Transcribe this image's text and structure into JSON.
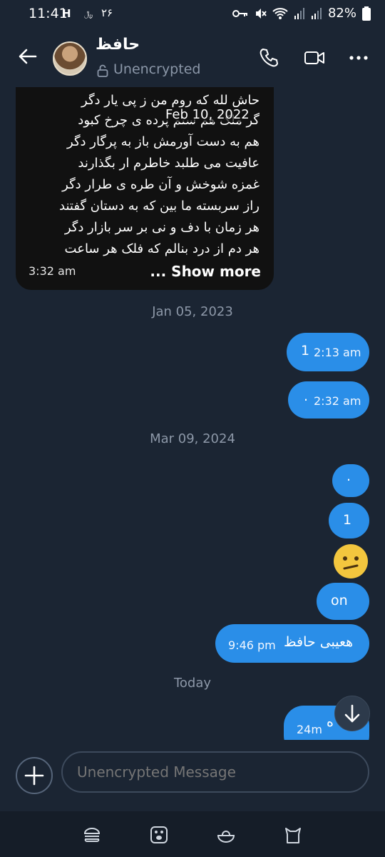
{
  "status_bar": {
    "time": "11:41",
    "indicator_text": "H",
    "small_text": "﷼",
    "number_text": "۲۶",
    "battery": "82%",
    "icons": [
      "key-icon",
      "mute-icon",
      "wifi-icon",
      "signal-icon",
      "signal-icon",
      "battery-icon"
    ]
  },
  "header": {
    "contact_name": "حافظ",
    "encryption_status": "Unencrypted",
    "icons": [
      "back-arrow-icon",
      "lock-icon",
      "phone-icon",
      "video-icon",
      "more-icon"
    ]
  },
  "messages": {
    "incoming_poem": {
      "lines": [
        "حاش لله که روم من ز پی یار دگر",
        "گر ملک هم ستم پرده ی چرخ کبود",
        "هم به دست آورمش باز به پرگار دگر",
        "عافیت می طلبد خاطرم ار بگذارند",
        "غمزه شوخش و آن طره ی طرار دگر",
        "راز سربسته ما بین که به دستان گفتند",
        "هر زمان با دف و نی بر سر بازار دگر",
        "هر دم از درد بنالم که فلک هر ساعت"
      ],
      "date_overlay": "Feb 10, 2022",
      "time": "3:32 am",
      "show_more": "... Show more"
    },
    "separator_1": "Jan 05, 2023",
    "outgoing_1": {
      "text": "1",
      "time": "2:13 am"
    },
    "outgoing_2": {
      "text": ".",
      "time": "2:32 am"
    },
    "separator_2": "Mar 09, 2024",
    "outgoing_3": {
      "text": "."
    },
    "outgoing_4": {
      "text": "1"
    },
    "outgoing_5": {
      "emoji": "confused-face-emoji"
    },
    "outgoing_6": {
      "text": "on"
    },
    "outgoing_7": {
      "text": "هعیبی حافظ",
      "time": "9:46 pm"
    },
    "separator_3": "Today",
    "outgoing_8": {
      "text": "ه",
      "time": "24m"
    }
  },
  "composer": {
    "placeholder": "Unencrypted Message",
    "icons": [
      "plus-icon"
    ]
  },
  "nav_bar": {
    "icons": [
      "burger-icon",
      "paw-icon",
      "cat-bowl-icon",
      "cat-icon"
    ]
  },
  "colors": {
    "background": "#1b2533",
    "outgoing_bubble": "#2a8ee8",
    "incoming_bubble": "#111111",
    "muted_text": "#8b97a8"
  }
}
